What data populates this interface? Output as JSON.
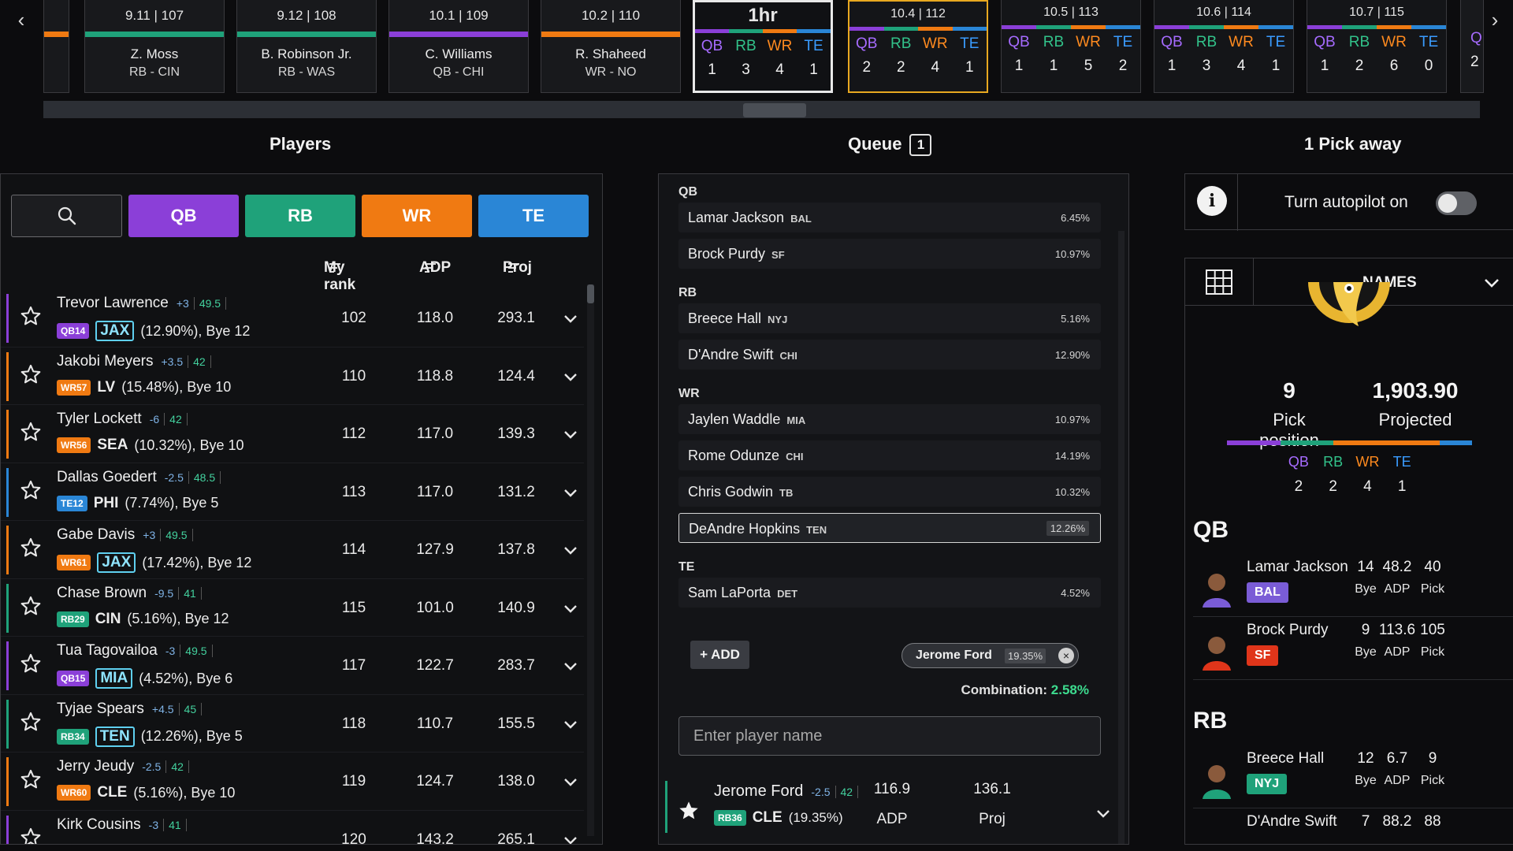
{
  "board": {
    "picks": [
      {
        "pick": "9.11 | 107",
        "name": "Z. Moss",
        "pos": "RB - CIN",
        "color": "#1fa27a"
      },
      {
        "pick": "9.12 | 108",
        "name": "B. Robinson Jr.",
        "pos": "RB - WAS",
        "color": "#1fa27a"
      },
      {
        "pick": "10.1 | 109",
        "name": "C. Williams",
        "pos": "QB - CHI",
        "color": "#8b3fd8"
      },
      {
        "pick": "10.2 | 110",
        "name": "R. Shaheed",
        "pos": "WR - NO",
        "color": "#f07a12"
      }
    ],
    "timer": {
      "label": "1hr",
      "counts": {
        "QB": "1",
        "RB": "3",
        "WR": "4",
        "TE": "1"
      }
    },
    "upcoming": [
      {
        "pick": "10.4 | 112",
        "counts": {
          "QB": "2",
          "RB": "2",
          "WR": "4",
          "TE": "1"
        },
        "current": true
      },
      {
        "pick": "10.5 | 113",
        "counts": {
          "QB": "1",
          "RB": "1",
          "WR": "5",
          "TE": "2"
        }
      },
      {
        "pick": "10.6 | 114",
        "counts": {
          "QB": "1",
          "RB": "3",
          "WR": "4",
          "TE": "1"
        }
      },
      {
        "pick": "10.7 | 115",
        "counts": {
          "QB": "1",
          "RB": "2",
          "WR": "6",
          "TE": "0"
        }
      }
    ],
    "partial_right_label": "Q",
    "partial_right_count": "2"
  },
  "sections": {
    "players": "Players",
    "queue": "Queue",
    "queue_count": "1",
    "pick_away": "1 Pick away"
  },
  "filters": {
    "qb": "QB",
    "rb": "RB",
    "wr": "WR",
    "te": "TE"
  },
  "columns": {
    "my_rank": "My rank",
    "adp": "ADP",
    "proj": "Proj"
  },
  "colors": {
    "qb": "#8b3fd8",
    "rb": "#1fa27a",
    "wr": "#f07a12",
    "te": "#2a86d6"
  },
  "players": [
    {
      "name": "Trevor Lawrence",
      "delta": "+3",
      "bye_adp": "49.5",
      "tag": "QB14",
      "pos": "qb",
      "team": "JAX",
      "boxed": true,
      "pct": "(12.90%)",
      "bye": ", Bye 12",
      "rank": "102",
      "adp": "118.0",
      "proj": "293.1"
    },
    {
      "name": "Jakobi Meyers",
      "delta": "+3.5",
      "bye_adp": "42",
      "tag": "WR57",
      "pos": "wr",
      "team": "LV",
      "boxed": false,
      "pct": "(15.48%)",
      "bye": ", Bye 10",
      "rank": "110",
      "adp": "118.8",
      "proj": "124.4"
    },
    {
      "name": "Tyler Lockett",
      "delta": "-6",
      "bye_adp": "42",
      "tag": "WR56",
      "pos": "wr",
      "team": "SEA",
      "boxed": false,
      "pct": "(10.32%)",
      "bye": ", Bye 10",
      "rank": "112",
      "adp": "117.0",
      "proj": "139.3"
    },
    {
      "name": "Dallas Goedert",
      "delta": "-2.5",
      "bye_adp": "48.5",
      "tag": "TE12",
      "pos": "te",
      "team": "PHI",
      "boxed": false,
      "pct": "(7.74%)",
      "bye": ", Bye 5",
      "rank": "113",
      "adp": "117.0",
      "proj": "131.2"
    },
    {
      "name": "Gabe Davis",
      "delta": "+3",
      "bye_adp": "49.5",
      "tag": "WR61",
      "pos": "wr",
      "team": "JAX",
      "boxed": true,
      "pct": "(17.42%)",
      "bye": ", Bye 12",
      "rank": "114",
      "adp": "127.9",
      "proj": "137.8"
    },
    {
      "name": "Chase Brown",
      "delta": "-9.5",
      "bye_adp": "41",
      "tag": "RB29",
      "pos": "rb",
      "team": "CIN",
      "boxed": false,
      "pct": "(5.16%)",
      "bye": ", Bye 12",
      "rank": "115",
      "adp": "101.0",
      "proj": "140.9"
    },
    {
      "name": "Tua Tagovailoa",
      "delta": "-3",
      "bye_adp": "49.5",
      "tag": "QB15",
      "pos": "qb",
      "team": "MIA",
      "boxed": true,
      "pct": "(4.52%)",
      "bye": ", Bye 6",
      "rank": "117",
      "adp": "122.7",
      "proj": "283.7"
    },
    {
      "name": "Tyjae Spears",
      "delta": "+4.5",
      "bye_adp": "45",
      "tag": "RB34",
      "pos": "rb",
      "team": "TEN",
      "boxed": true,
      "pct": "(12.26%)",
      "bye": ", Bye 5",
      "rank": "118",
      "adp": "110.7",
      "proj": "155.5"
    },
    {
      "name": "Jerry Jeudy",
      "delta": "-2.5",
      "bye_adp": "42",
      "tag": "WR60",
      "pos": "wr",
      "team": "CLE",
      "boxed": false,
      "pct": "(5.16%)",
      "bye": ", Bye 10",
      "rank": "119",
      "adp": "124.7",
      "proj": "138.0"
    },
    {
      "name": "Kirk Cousins",
      "delta": "-3",
      "bye_adp": "41",
      "tag": "",
      "pos": "qb",
      "team": "",
      "boxed": false,
      "pct": "",
      "bye": "",
      "rank": "120",
      "adp": "143.2",
      "proj": "265.1"
    }
  ],
  "queue": {
    "groups": [
      {
        "label": "QB",
        "items": [
          {
            "name": "Lamar Jackson",
            "team": "BAL",
            "pct": "6.45%"
          },
          {
            "name": "Brock Purdy",
            "team": "SF",
            "pct": "10.97%"
          }
        ]
      },
      {
        "label": "RB",
        "items": [
          {
            "name": "Breece Hall",
            "team": "NYJ",
            "pct": "5.16%"
          },
          {
            "name": "D'Andre Swift",
            "team": "CHI",
            "pct": "12.90%"
          }
        ]
      },
      {
        "label": "WR",
        "items": [
          {
            "name": "Jaylen Waddle",
            "team": "MIA",
            "pct": "10.97%"
          },
          {
            "name": "Rome Odunze",
            "team": "CHI",
            "pct": "14.19%"
          },
          {
            "name": "Chris Godwin",
            "team": "TB",
            "pct": "10.32%"
          },
          {
            "name": "DeAndre Hopkins",
            "team": "TEN",
            "pct": "12.26%",
            "selected": true
          }
        ]
      },
      {
        "label": "TE",
        "items": [
          {
            "name": "Sam LaPorta",
            "team": "DET",
            "pct": "4.52%"
          }
        ]
      }
    ],
    "add_label": "+ ADD",
    "chip": {
      "name": "Jerome Ford",
      "pct": "19.35%",
      "close": "×"
    },
    "combination_label": "Combination:",
    "combination_value": "2.58%",
    "input_placeholder": "Enter player name",
    "player": {
      "name": "Jerome Ford",
      "delta": "-2.5",
      "bye_adp": "42",
      "tag": "RB36",
      "team": "CLE",
      "pct": "(19.35%)",
      "adp": "116.9",
      "adp_label": "ADP",
      "proj": "136.1",
      "proj_label": "Proj"
    }
  },
  "autopilot": {
    "info": "i",
    "label": "Turn autopilot on",
    "on": false
  },
  "team": {
    "view_label": "NAMES",
    "pick_position": "9",
    "pick_position_label": "Pick position",
    "projected": "1,903.90",
    "projected_label": "Projected",
    "counts": {
      "QB": "2",
      "RB": "2",
      "WR": "4",
      "TE": "1"
    },
    "qb_label": "QB",
    "rb_label": "RB",
    "roster": [
      {
        "name": "Lamar Jackson",
        "team": "BAL",
        "team_color": "#7a5cd6",
        "bye": "14",
        "adp": "48.2",
        "pick": "40"
      },
      {
        "name": "Brock Purdy",
        "team": "SF",
        "team_color": "#e0351a",
        "bye": "9",
        "adp": "113.6",
        "pick": "105"
      },
      {
        "name": "Breece Hall",
        "team": "NYJ",
        "team_color": "#1fa27a",
        "bye": "12",
        "adp": "6.7",
        "pick": "9"
      },
      {
        "name": "D'Andre Swift",
        "team": "",
        "team_color": "",
        "bye": "7",
        "adp": "88.2",
        "pick": "88"
      }
    ],
    "stat_labels": {
      "bye": "Bye",
      "adp": "ADP",
      "pick": "Pick"
    }
  }
}
